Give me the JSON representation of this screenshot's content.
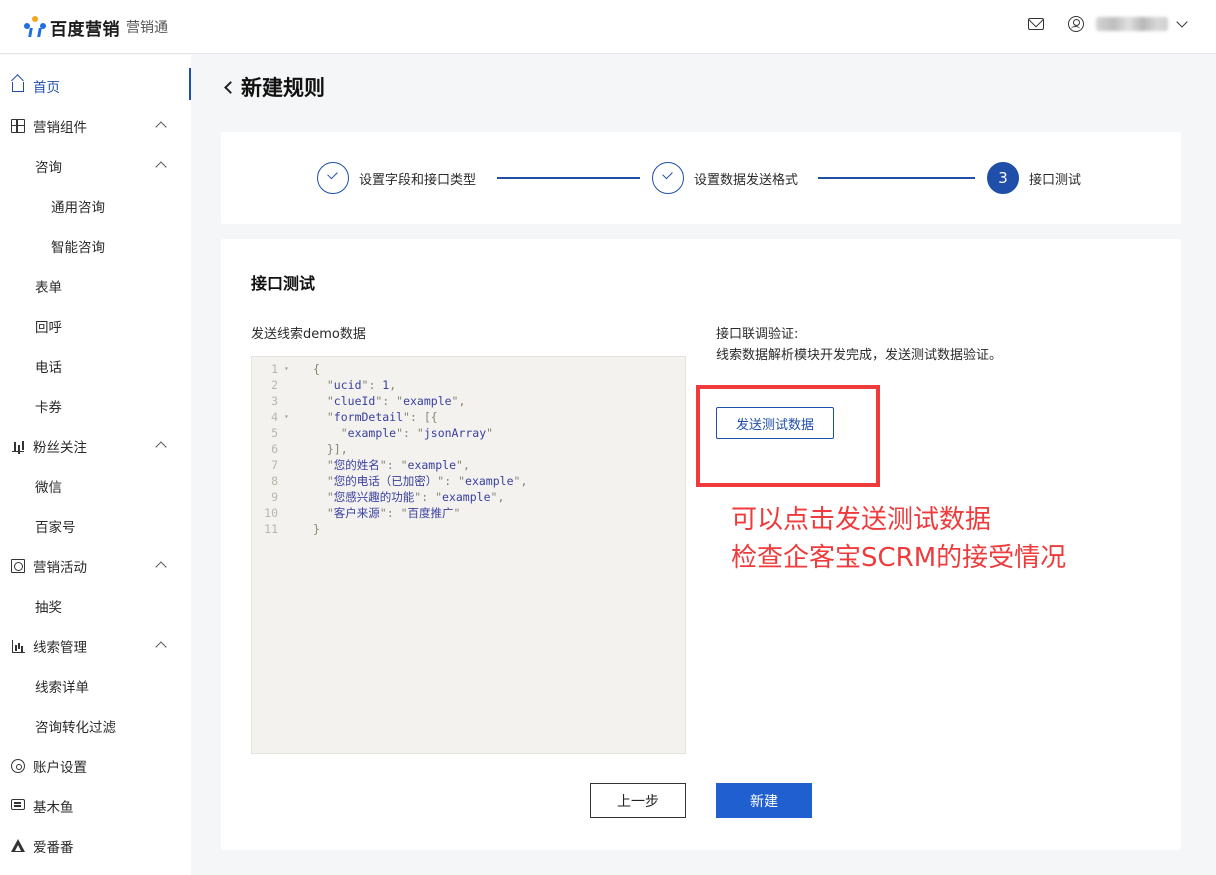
{
  "header": {
    "brand": "百度营销",
    "product": "营销通"
  },
  "sidebar": {
    "items": [
      {
        "label": "首页",
        "icon": "home-icon"
      },
      {
        "label": "营销组件",
        "icon": "grid-icon"
      },
      {
        "label": "咨询"
      },
      {
        "label": "通用咨询"
      },
      {
        "label": "智能咨询"
      },
      {
        "label": "表单"
      },
      {
        "label": "回呼"
      },
      {
        "label": "电话"
      },
      {
        "label": "卡券"
      },
      {
        "label": "粉丝关注",
        "icon": "bar-chart-icon"
      },
      {
        "label": "微信"
      },
      {
        "label": "百家号"
      },
      {
        "label": "营销活动",
        "icon": "gift-icon"
      },
      {
        "label": "抽奖"
      },
      {
        "label": "线索管理",
        "icon": "chart-icon"
      },
      {
        "label": "线索详单"
      },
      {
        "label": "咨询转化过滤"
      },
      {
        "label": "账户设置",
        "icon": "settings-icon"
      },
      {
        "label": "基木鱼",
        "icon": "message-icon"
      },
      {
        "label": "爱番番",
        "icon": "triangle-logo-icon"
      }
    ]
  },
  "page": {
    "title": "新建规则"
  },
  "steps": [
    {
      "label": "设置字段和接口类型",
      "state": "done"
    },
    {
      "label": "设置数据发送格式",
      "state": "done"
    },
    {
      "label": "接口测试",
      "state": "current",
      "number": "3"
    }
  ],
  "content": {
    "section_title": "接口测试",
    "demo_label": "发送线索demo数据",
    "verify_title": "接口联调验证:",
    "verify_desc": "线索数据解析模块开发完成，发送测试数据验证。",
    "send_button": "发送测试数据",
    "annotation_line1": "可以点击发送测试数据",
    "annotation_line2": "检查企客宝SCRM的接受情况",
    "annotation_color": "#ef3b3b"
  },
  "code": {
    "lines": [
      {
        "n": "1",
        "fold": "▾",
        "text": "{"
      },
      {
        "n": "2",
        "fold": "",
        "text": "  \"ucid\": 1,"
      },
      {
        "n": "3",
        "fold": "",
        "text": "  \"clueId\": \"example\","
      },
      {
        "n": "4",
        "fold": "▾",
        "text": "  \"formDetail\": [{"
      },
      {
        "n": "5",
        "fold": "",
        "text": "    \"example\": \"jsonArray\""
      },
      {
        "n": "6",
        "fold": "",
        "text": "  }],"
      },
      {
        "n": "7",
        "fold": "",
        "text": "  \"您的姓名\": \"example\","
      },
      {
        "n": "8",
        "fold": "",
        "text": "  \"您的电话（已加密）\": \"example\","
      },
      {
        "n": "9",
        "fold": "",
        "text": "  \"您感兴趣的功能\": \"example\","
      },
      {
        "n": "10",
        "fold": "",
        "text": "  \"客户来源\": \"百度推广\""
      },
      {
        "n": "11",
        "fold": "",
        "text": "}"
      }
    ]
  },
  "footer": {
    "prev_button": "上一步",
    "create_button": "新建"
  },
  "colors": {
    "primary": "#1f4fa8",
    "button_primary": "#1f5fd0",
    "annotation_red": "#ef3b3b"
  }
}
